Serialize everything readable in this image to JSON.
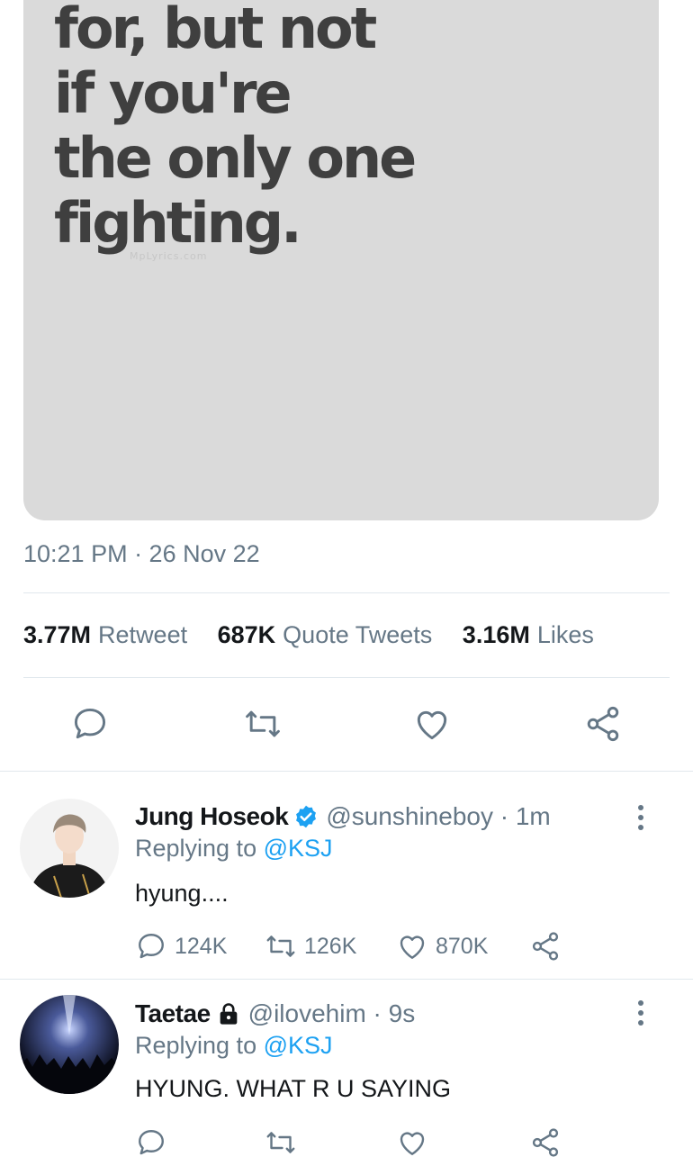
{
  "tweet": {
    "image_text": "for, but not\nif you're\nthe only one\nfighting.",
    "watermark": "MpLyrics.com",
    "timestamp": "10:21 PM · 26 Nov 22",
    "stats": [
      {
        "value": "3.77M",
        "label": "Retweet"
      },
      {
        "value": "687K",
        "label": "Quote Tweets"
      },
      {
        "value": "3.16M",
        "label": "Likes"
      }
    ]
  },
  "replies": [
    {
      "name": "Jung Hoseok",
      "badge": "verified-badge-icon",
      "handle": "@sunshineboy · 1m",
      "replying_prefix": "Replying to",
      "replying_to": "@KSJ",
      "text": "hyung....",
      "replies_count": "124K",
      "retweets_count": "126K",
      "likes_count": "870K"
    },
    {
      "name": "Taetae",
      "badge": "lock-icon",
      "handle": "@ilovehim · 9s",
      "replying_prefix": "Replying to",
      "replying_to": "@KSJ",
      "text": "HYUNG. WHAT R U SAYING",
      "replies_count": "",
      "retweets_count": "",
      "likes_count": ""
    }
  ],
  "colors": {
    "accent": "#1da1f2",
    "secondary_text": "#657786",
    "divider": "#e1e8ed"
  }
}
